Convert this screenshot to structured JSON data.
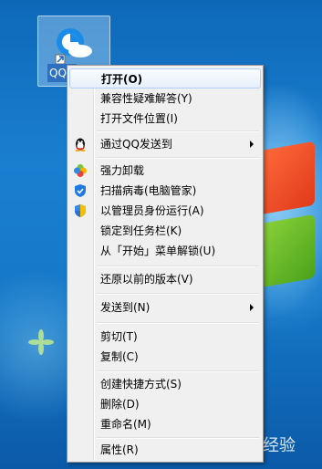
{
  "desktop": {
    "icon_label": "QQ",
    "watermark_text": "Bai经验"
  },
  "menu": {
    "items": [
      {
        "label": "打开(O)",
        "icon": "",
        "arrow": false,
        "bold": true,
        "highlight": true
      },
      {
        "label": "兼容性疑难解答(Y)",
        "icon": "",
        "arrow": false
      },
      {
        "label": "打开文件位置(I)",
        "icon": "",
        "arrow": false
      },
      {
        "label": "通过QQ发送到",
        "icon": "qq-penguin-icon",
        "arrow": true
      },
      {
        "label": "强力卸载",
        "icon": "pinwheel-icon",
        "arrow": false
      },
      {
        "label": "扫描病毒(电脑管家)",
        "icon": "shield-check-icon",
        "arrow": false
      },
      {
        "label": "以管理员身份运行(A)",
        "icon": "uac-shield-icon",
        "arrow": false
      },
      {
        "label": "锁定到任务栏(K)",
        "icon": "",
        "arrow": false
      },
      {
        "label": "从「开始」菜单解锁(U)",
        "icon": "",
        "arrow": false
      },
      {
        "label": "还原以前的版本(V)",
        "icon": "",
        "arrow": false
      },
      {
        "label": "发送到(N)",
        "icon": "",
        "arrow": true
      },
      {
        "label": "剪切(T)",
        "icon": "",
        "arrow": false
      },
      {
        "label": "复制(C)",
        "icon": "",
        "arrow": false
      },
      {
        "label": "创建快捷方式(S)",
        "icon": "",
        "arrow": false
      },
      {
        "label": "删除(D)",
        "icon": "",
        "arrow": false
      },
      {
        "label": "重命名(M)",
        "icon": "",
        "arrow": false
      },
      {
        "label": "属性(R)",
        "icon": "",
        "arrow": false
      }
    ]
  },
  "colors": {
    "desktop_blue": "#1577c7",
    "menu_bg": "#f0f0f0",
    "highlight_border": "#aecff7"
  }
}
